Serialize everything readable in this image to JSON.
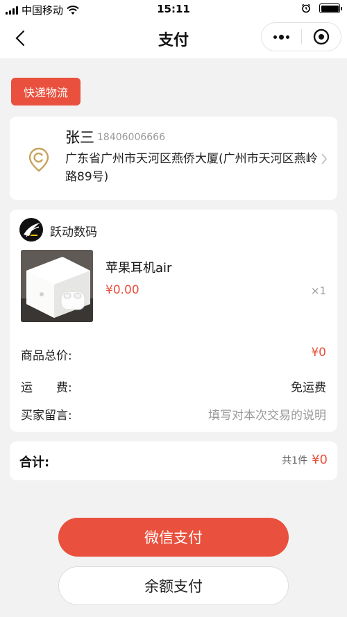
{
  "status_bar": {
    "carrier": "中国移动",
    "time": "15:11"
  },
  "nav": {
    "title": "支付"
  },
  "express_tag": "快递物流",
  "address": {
    "name": "张三",
    "phone": "18406006666",
    "text": "广东省广州市天河区燕侨大厦(广州市天河区燕岭路89号)"
  },
  "shop": {
    "name": "跃动数码"
  },
  "product": {
    "name": "苹果耳机air",
    "price": "¥0.00",
    "qty": "×1"
  },
  "summary": {
    "subtotal_label": "商品总价:",
    "subtotal_value": "¥0",
    "shipping_label": "运　　费:",
    "shipping_value": "免运费",
    "message_label": "买家留言:",
    "message_placeholder": "填写对本次交易的说明"
  },
  "total": {
    "label": "合计:",
    "count": "共1件",
    "amount": "¥0"
  },
  "buttons": {
    "wechat_pay": "微信支付",
    "balance_pay": "余额支付"
  },
  "colors": {
    "accent": "#e9503d",
    "background": "#f2f2f2",
    "address_icon": "#c9a15a"
  }
}
